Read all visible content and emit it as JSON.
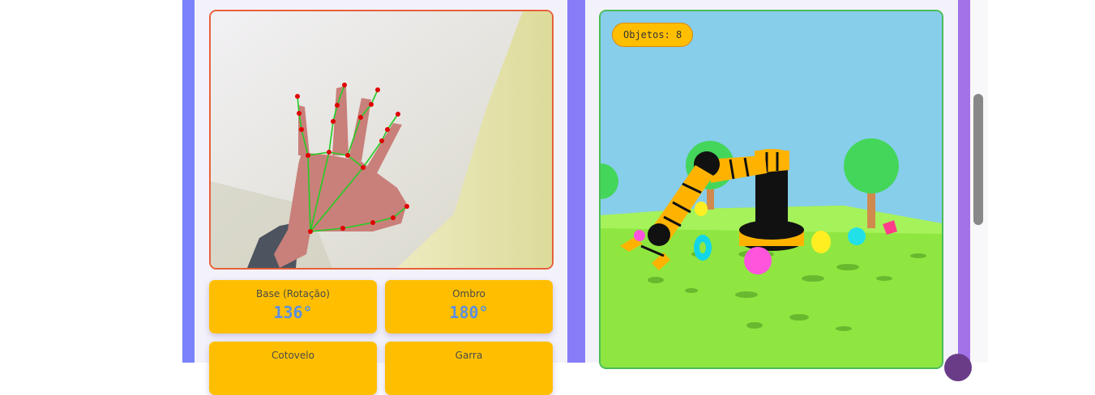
{
  "simulation": {
    "objects_badge": "Objetos: 8"
  },
  "joints": [
    {
      "label": "Base (Rotação)",
      "value": "136°"
    },
    {
      "label": "Ombro",
      "value": "180°"
    },
    {
      "label": "Cotovelo",
      "value": ""
    },
    {
      "label": "Garra",
      "value": ""
    }
  ],
  "colors": {
    "accent": "#ffbf00",
    "value_text": "#5b8fe0",
    "camera_border": "#e8603a",
    "sim_border": "#4cbc5a",
    "landmark": "#e00000",
    "skeleton": "#22cc22"
  }
}
